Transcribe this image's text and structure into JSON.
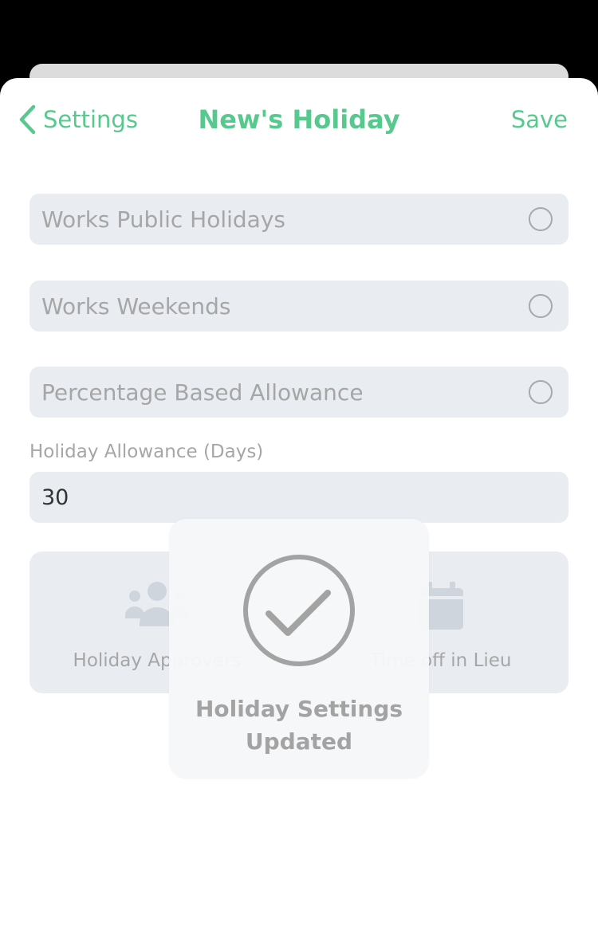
{
  "nav": {
    "back_label": "Settings",
    "title": "New's Holiday",
    "save_label": "Save"
  },
  "toggles": [
    {
      "label": "Works Public Holidays",
      "checked": false
    },
    {
      "label": "Works Weekends",
      "checked": false
    },
    {
      "label": "Percentage Based Allowance",
      "checked": false
    }
  ],
  "allowance": {
    "label": "Holiday Allowance (Days)",
    "value": "30"
  },
  "tiles": {
    "left": {
      "label": "Holiday Approvers",
      "icon": "users-icon"
    },
    "right": {
      "label": "Time off in Lieu",
      "icon": "calendar-icon"
    }
  },
  "toast": {
    "line1": "Holiday Settings",
    "line2": "Updated",
    "icon": "checkmark-circle-icon"
  },
  "colors": {
    "accent": "#58c98e",
    "field_bg": "#e9edf1",
    "muted_text": "#a6a6a6"
  }
}
